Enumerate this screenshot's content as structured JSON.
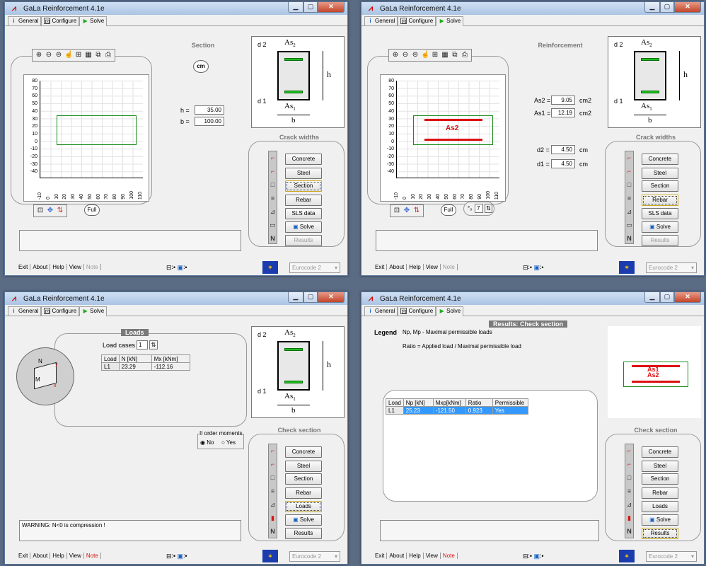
{
  "app_title": "GaLa Reinforcement  4.1e",
  "tabs": {
    "general": "General",
    "configure": "Configure",
    "solve": "Solve"
  },
  "bottom_bar": {
    "exit": "Exit",
    "about": "About",
    "help": "Help",
    "view": "View",
    "note": "Note",
    "standard": "Eurocode 2"
  },
  "full_label": "Full",
  "cm_label": "cm",
  "y_ticks": [
    "80",
    "70",
    "60",
    "50",
    "40",
    "30",
    "20",
    "10",
    "0",
    "-10",
    "-20",
    "-30",
    "-40"
  ],
  "x_ticks": [
    "-10",
    "0",
    "10",
    "20",
    "30",
    "40",
    "50",
    "60",
    "70",
    "80",
    "90",
    "100",
    "110"
  ],
  "schematic": {
    "d2": "d 2",
    "d1": "d 1",
    "as_top": "As",
    "as_top_sub": "2",
    "as_bot": "As",
    "as_bot_sub": "1",
    "h": "h",
    "b": "b"
  },
  "window1": {
    "section_title": "Section",
    "h_label": "h =",
    "h_value": "35.00",
    "b_label": "b =",
    "b_value": "100.00",
    "side_title": "Crack widths",
    "buttons": [
      "Concrete",
      "Steel",
      "Section",
      "Rebar",
      "SLS data",
      "Solve",
      "Results"
    ]
  },
  "window2": {
    "section_title": "Reinforcement",
    "as2_label": "As2 =",
    "as2_value": "9.05",
    "as2_unit": "cm2",
    "as1_label": "As1 =",
    "as1_value": "12.19",
    "as1_unit": "cm2",
    "d2_label": "d2 =",
    "d2_value": "4.50",
    "d2_unit": "cm",
    "d1_label": "d1 =",
    "d1_value": "4.50",
    "d1_unit": "cm",
    "plot_label": "As2",
    "spinner_value": "7",
    "side_title": "Crack widths",
    "buttons": [
      "Concrete",
      "Steel",
      "Section",
      "Rebar",
      "SLS data",
      "Solve",
      "Results"
    ]
  },
  "window3": {
    "loads_title": "Loads",
    "load_cases_label": "Load cases",
    "load_cases_value": "1",
    "table_headers": [
      "Load",
      "N  [kN]",
      "Mx [kNm]"
    ],
    "table_rows": [
      [
        "L1",
        "23.29",
        "-112.16"
      ]
    ],
    "order_title": "II order moments",
    "order_no": "No",
    "order_yes": "Yes",
    "side_title": "Check section",
    "buttons": [
      "Concrete",
      "Steel",
      "Section",
      "Rebar",
      "Loads",
      "Solve",
      "Results"
    ],
    "warning": "WARNING:  N<0 is compression !",
    "diagram_labels": {
      "n": "N",
      "m": "M",
      "x": "x",
      "y": "y"
    }
  },
  "window4": {
    "results_title": "Results: Check section",
    "legend_label": "Legend",
    "legend_line1": "Np, Mp  - Maximal permissible loads",
    "legend_line2": "Ratio  =  Applied load / Maximal permissible load",
    "table_headers": [
      "Load",
      "Np [kN]",
      "Mxp[kNm]",
      "Ratio",
      "Permissible"
    ],
    "table_rows": [
      [
        "L1",
        "25.23",
        "-121.50",
        "0.923",
        "Yes"
      ]
    ],
    "plot_label1": "As1",
    "plot_label2": "As2",
    "side_title": "Check section",
    "buttons": [
      "Concrete",
      "Steel",
      "Section",
      "Rebar",
      "Loads",
      "Solve",
      "Results"
    ]
  }
}
